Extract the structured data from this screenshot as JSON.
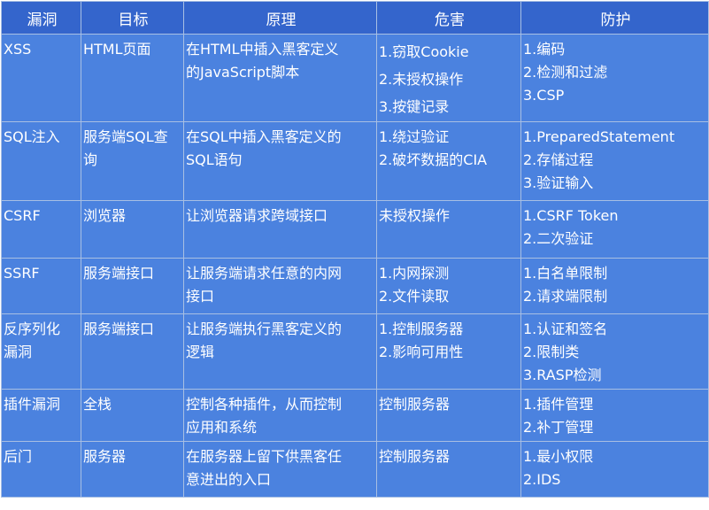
{
  "table": {
    "headers": [
      "漏洞",
      "目标",
      "原理",
      "危害",
      "防护"
    ],
    "rows": [
      {
        "vuln": [
          "XSS"
        ],
        "target": [
          "HTML页面"
        ],
        "principle": [
          "在HTML中插入黑客定义",
          "的JavaScript脚本"
        ],
        "harm": [
          "1.窃取Cookie",
          "2.未授权操作",
          "3.按键记录"
        ],
        "defense": [
          "1.编码",
          "2.检测和过滤",
          "3.CSP"
        ]
      },
      {
        "vuln": [
          "SQL注入"
        ],
        "target": [
          "服务端SQL查",
          "询"
        ],
        "principle": [
          "在SQL中插入黑客定义的",
          "SQL语句"
        ],
        "harm": [
          "1.绕过验证",
          "2.破坏数据的CIA"
        ],
        "defense": [
          "1.PreparedStatement",
          "2.存储过程",
          "3.验证输入"
        ]
      },
      {
        "vuln": [
          "CSRF"
        ],
        "target": [
          "浏览器"
        ],
        "principle": [
          "让浏览器请求跨域接口"
        ],
        "harm": [
          "未授权操作"
        ],
        "defense": [
          "1.CSRF Token",
          "2.二次验证"
        ]
      },
      {
        "vuln": [
          "SSRF"
        ],
        "target": [
          "服务端接口"
        ],
        "principle": [
          "让服务端请求任意的内网",
          "接口"
        ],
        "harm": [
          "1.内网探测",
          "2.文件读取"
        ],
        "defense": [
          "1.白名单限制",
          "2.请求端限制"
        ]
      },
      {
        "vuln": [
          "反序列化",
          "漏洞"
        ],
        "target": [
          "服务端接口"
        ],
        "principle": [
          "让服务端执行黑客定义的",
          "逻辑"
        ],
        "harm": [
          "1.控制服务器",
          "2.影响可用性"
        ],
        "defense": [
          "1.认证和签名",
          "2.限制类",
          "3.RASP检测"
        ]
      },
      {
        "vuln": [
          "插件漏洞"
        ],
        "target": [
          "全栈"
        ],
        "principle": [
          "控制各种插件，从而控制",
          "应用和系统"
        ],
        "harm": [
          "控制服务器"
        ],
        "defense": [
          "1.插件管理",
          "2.补丁管理"
        ]
      },
      {
        "vuln": [
          "后门"
        ],
        "target": [
          "服务器"
        ],
        "principle": [
          "在服务器上留下供黑客任",
          "意进出的入口"
        ],
        "harm": [
          "控制服务器"
        ],
        "defense": [
          "1.最小权限",
          "2.IDS"
        ]
      }
    ]
  }
}
